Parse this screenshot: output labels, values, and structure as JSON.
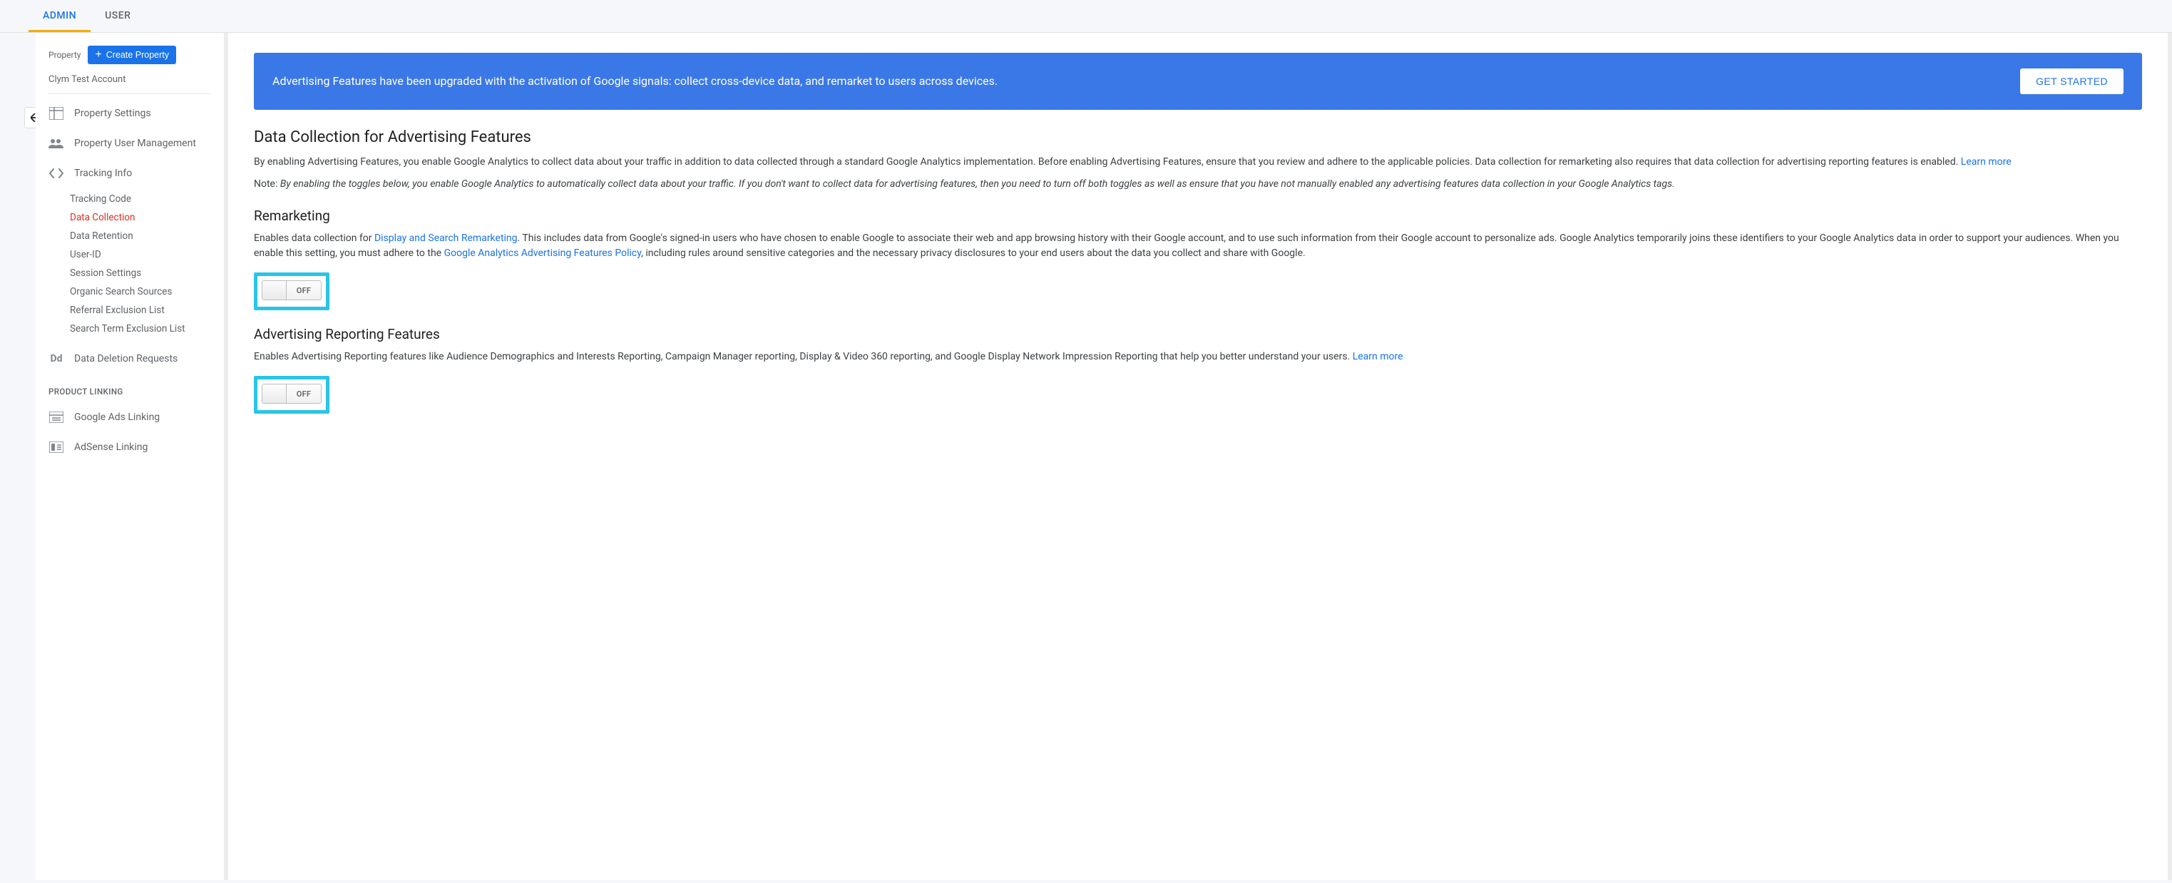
{
  "tabs": {
    "admin": "ADMIN",
    "user": "USER"
  },
  "sidebar": {
    "property_label": "Property",
    "create_btn": "Create Property",
    "account_name": "Clym Test Account",
    "items": {
      "property_settings": "Property Settings",
      "property_user_mgmt": "Property User Management",
      "tracking_info": "Tracking Info",
      "data_deletion": "Data Deletion Requests",
      "google_ads_linking": "Google Ads Linking",
      "adsense_linking": "AdSense Linking"
    },
    "tracking_sub": [
      "Tracking Code",
      "Data Collection",
      "Data Retention",
      "User-ID",
      "Session Settings",
      "Organic Search Sources",
      "Referral Exclusion List",
      "Search Term Exclusion List"
    ],
    "section_product_linking": "PRODUCT LINKING"
  },
  "banner": {
    "text": "Advertising Features have been upgraded with the activation of Google signals: collect cross-device data, and remarket to users across devices.",
    "cta": "GET STARTED"
  },
  "main": {
    "h1": "Data Collection for Advertising Features",
    "intro": "By enabling Advertising Features, you enable Google Analytics to collect data about your traffic in addition to data collected through a standard Google Analytics implementation. Before enabling Advertising Features, ensure that you review and adhere to the applicable policies. Data collection for remarketing also requires that data collection for advertising reporting features is enabled. ",
    "learn_more": "Learn more",
    "note_label": "Note: ",
    "note_text": "By enabling the toggles below, you enable Google Analytics to automatically collect data about your traffic. If you don't want to collect data for advertising features, then you need to turn off both toggles as well as ensure that you have not manually enabled any advertising features data collection in your Google Analytics tags.",
    "remarketing_h": "Remarketing",
    "remarketing_p1": "Enables data collection for ",
    "remarketing_link1": "Display and Search Remarketing",
    "remarketing_p2": ". This includes data from Google's signed-in users who have chosen to enable Google to associate their web and app browsing history with their Google account, and to use such information from their Google account to personalize ads. Google Analytics temporarily joins these identifiers to your Google Analytics data in order to support your audiences. When you enable this setting, you must adhere to the ",
    "remarketing_link2": "Google Analytics Advertising Features Policy",
    "remarketing_p3": ", including rules around sensitive categories and the necessary privacy disclosures to your end users about the data you collect and share with Google.",
    "toggle_off": "OFF",
    "arf_h": "Advertising Reporting Features",
    "arf_p1": "Enables Advertising Reporting features like Audience Demographics and Interests Reporting, Campaign Manager reporting, Display & Video 360 reporting, and Google Display Network Impression Reporting that help you better understand your users. "
  }
}
